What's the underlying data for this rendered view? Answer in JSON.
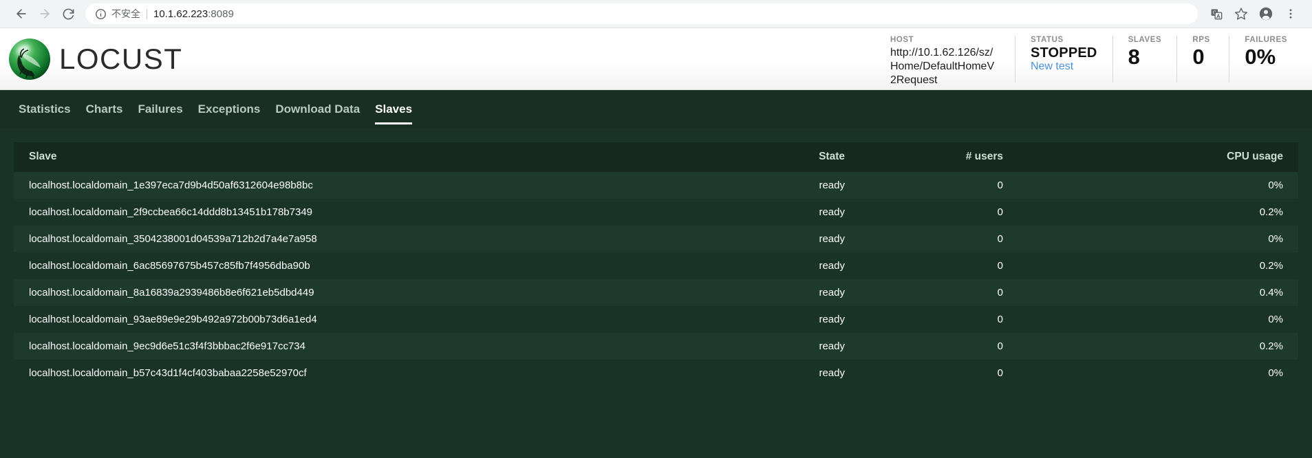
{
  "browser": {
    "back_icon": "arrow-left-icon",
    "forward_icon": "arrow-right-icon",
    "reload_icon": "reload-icon",
    "info_icon": "info-circle-icon",
    "insecure_label": "不安全",
    "url": "10.1.62.223",
    "url_port": ":8089",
    "translate_icon": "translate-icon",
    "bookmark_icon": "star-icon",
    "profile_icon": "account-circle-icon",
    "menu_icon": "more-vertical-icon"
  },
  "header": {
    "logo_icon": "locust-logo-icon",
    "brand": "LOCUST",
    "stats": {
      "host_label": "HOST",
      "host_value": "http://10.1.62.126/sz/Home/DefaultHomeV2Request",
      "status_label": "STATUS",
      "status_value": "STOPPED",
      "status_link": "New test",
      "slaves_label": "SLAVES",
      "slaves_value": "8",
      "rps_label": "RPS",
      "rps_value": "0",
      "failures_label": "FAILURES",
      "failures_value": "0%"
    }
  },
  "nav": {
    "tabs": [
      {
        "label": "Statistics",
        "active": false
      },
      {
        "label": "Charts",
        "active": false
      },
      {
        "label": "Failures",
        "active": false
      },
      {
        "label": "Exceptions",
        "active": false
      },
      {
        "label": "Download Data",
        "active": false
      },
      {
        "label": "Slaves",
        "active": true
      }
    ]
  },
  "table": {
    "columns": {
      "slave": "Slave",
      "state": "State",
      "users": "# users",
      "cpu": "CPU usage"
    },
    "rows": [
      {
        "slave": "localhost.localdomain_1e397eca7d9b4d50af6312604e98b8bc",
        "state": "ready",
        "users": "0",
        "cpu": "0%"
      },
      {
        "slave": "localhost.localdomain_2f9ccbea66c14ddd8b13451b178b7349",
        "state": "ready",
        "users": "0",
        "cpu": "0.2%"
      },
      {
        "slave": "localhost.localdomain_3504238001d04539a712b2d7a4e7a958",
        "state": "ready",
        "users": "0",
        "cpu": "0%"
      },
      {
        "slave": "localhost.localdomain_6ac85697675b457c85fb7f4956dba90b",
        "state": "ready",
        "users": "0",
        "cpu": "0.2%"
      },
      {
        "slave": "localhost.localdomain_8a16839a2939486b8e6f621eb5dbd449",
        "state": "ready",
        "users": "0",
        "cpu": "0.4%"
      },
      {
        "slave": "localhost.localdomain_93ae89e9e29b492a972b00b73d6a1ed4",
        "state": "ready",
        "users": "0",
        "cpu": "0%"
      },
      {
        "slave": "localhost.localdomain_9ec9d6e51c3f4f3bbbac2f6e917cc734",
        "state": "ready",
        "users": "0",
        "cpu": "0.2%"
      },
      {
        "slave": "localhost.localdomain_b57c43d1f4cf403babaa2258e52970cf",
        "state": "ready",
        "users": "0",
        "cpu": "0%"
      }
    ]
  },
  "colors": {
    "nav_bg": "#192f24",
    "content_bg": "#1a3329",
    "link": "#4a90d9"
  }
}
